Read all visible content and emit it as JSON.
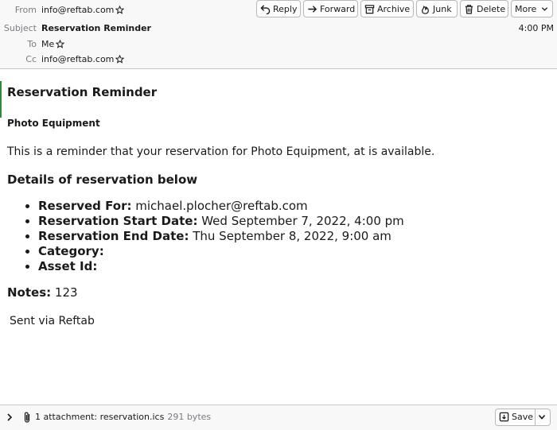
{
  "header": {
    "from_label": "From",
    "from_value": "info@reftab.com",
    "subject_label": "Subject",
    "subject_value": "Reservation Reminder",
    "to_label": "To",
    "to_value": "Me",
    "cc_label": "Cc",
    "cc_value": "info@reftab.com",
    "time": "4:00 PM"
  },
  "toolbar": {
    "reply": "Reply",
    "forward": "Forward",
    "archive": "Archive",
    "junk": "Junk",
    "delete": "Delete",
    "more": "More"
  },
  "message": {
    "title": "Reservation Reminder",
    "subtitle": "Photo Equipment",
    "paragraph": "This is a reminder that your reservation for Photo Equipment, at is available.",
    "details_heading": "Details of reservation below",
    "details": [
      {
        "label": "Reserved For:",
        "value": "michael.plocher@reftab.com"
      },
      {
        "label": "Reservation Start Date:",
        "value": "Wed September 7, 2022, 4:00 pm"
      },
      {
        "label": "Reservation End Date:",
        "value": "Thu September 8, 2022, 9:00 am"
      },
      {
        "label": "Category:",
        "value": ""
      },
      {
        "label": "Asset Id:",
        "value": ""
      }
    ],
    "notes_label": "Notes:",
    "notes_value": "123",
    "signature": "Sent via Reftab"
  },
  "footer": {
    "attachment_text": "1 attachment: reservation.ics",
    "attachment_size": "291 bytes",
    "save_label": "Save"
  },
  "colors": {
    "header_bg": "#f8f8f9",
    "border": "#c9c9cc",
    "label_gray": "#7c7c80"
  }
}
